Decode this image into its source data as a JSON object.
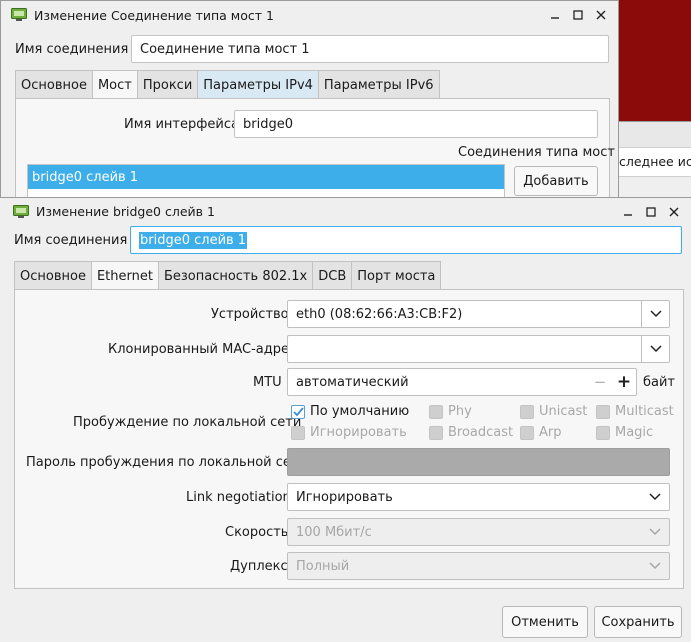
{
  "bg_window": {
    "title": "Изменение Соединение типа мост 1",
    "conn_name_label": "Имя соединения",
    "conn_name_value": "Соединение типа мост 1",
    "tabs": [
      "Основное",
      "Мост",
      "Прокси",
      "Параметры IPv4",
      "Параметры IPv6"
    ],
    "active_tab": "Мост",
    "iface_label": "Имя интерфейса",
    "iface_value": "bridge0",
    "bridge_conns_label": "Соединения типа мост",
    "slave_item": "bridge0 слейв 1",
    "add_button": "Добавить"
  },
  "far_window": {
    "partial_text": "следнее исп"
  },
  "fg_window": {
    "title": "Изменение bridge0 слейв 1",
    "conn_name_label": "Имя соединения",
    "conn_name_value": "bridge0 слейв 1",
    "tabs": [
      "Основное",
      "Ethernet",
      "Безопасность 802.1x",
      "DCB",
      "Порт моста"
    ],
    "active_tab": "Ethernet",
    "device_label": "Устройство",
    "device_value": "eth0 (08:62:66:A3:CB:F2)",
    "mac_label": "Клонированный MAC-адрес",
    "mac_value": "",
    "mtu_label": "MTU",
    "mtu_value": "автоматический",
    "mtu_minus": "−",
    "mtu_plus": "+",
    "mtu_unit": "байт",
    "wol_label": "Пробуждение по локальной сети",
    "wol_options": {
      "default": "По умолчанию",
      "phy": "Phy",
      "unicast": "Unicast",
      "multicast": "Multicast",
      "ignore": "Игнорировать",
      "broadcast": "Broadcast",
      "arp": "Arp",
      "magic": "Magic"
    },
    "wol_password_label": "Пароль пробуждения по локальной сети",
    "link_label": "Link negotiation",
    "link_value": "Игнорировать",
    "speed_label": "Скорость",
    "speed_value": "100 Мбит/с",
    "duplex_label": "Дуплекс",
    "duplex_value": "Полный",
    "cancel_button": "Отменить",
    "save_button": "Сохранить"
  },
  "colors": {
    "desktop": "#8b0a0a",
    "selection": "#3daee9",
    "tab_highlight": "#d8e9f4",
    "check_accent": "#3d8fd1"
  }
}
